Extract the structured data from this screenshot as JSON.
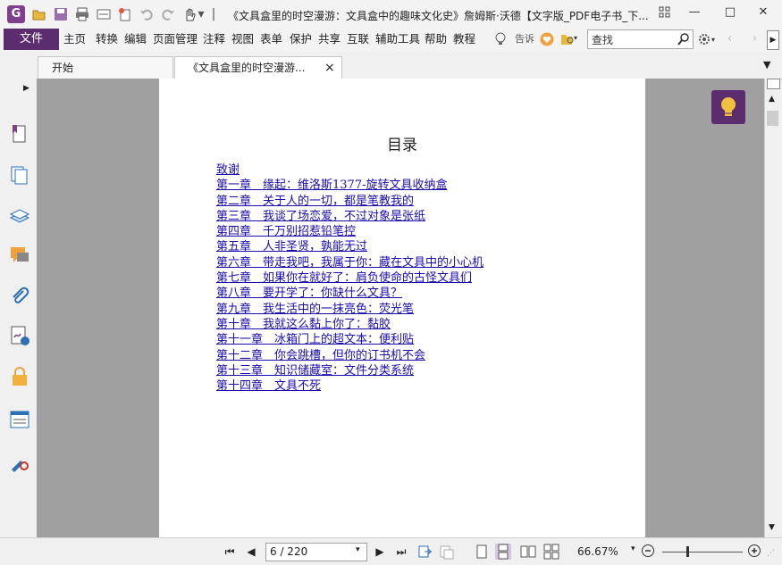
{
  "window": {
    "title": "《文具盒里的时空漫游：文具盒中的趣味文化史》詹姆斯·沃德【文字版_PDF电子书_下...",
    "minimize": "—",
    "maximize": "□",
    "close": "✕"
  },
  "app_icon": "G",
  "menu": {
    "file": "文件",
    "items": [
      "主页",
      "转换",
      "编辑",
      "页面管理",
      "注释",
      "视图",
      "表单",
      "保护",
      "共享",
      "互联",
      "辅助工具",
      "帮助",
      "教程"
    ],
    "tell": "告诉",
    "search_placeholder": "查找"
  },
  "tabs": [
    {
      "label": "开始"
    },
    {
      "label": "《文具盒里的时空漫游...",
      "close": "×"
    }
  ],
  "document": {
    "toc_title": "目录",
    "toc": [
      "致谢",
      "第一章　缘起：维洛斯1377-旋转文具收纳盒",
      "第二章　关于人的一切，都是笔教我的",
      "第三章　我谈了场恋爱，不过对象是张纸",
      "第四章　千万别招惹铅笔控",
      "第五章　人非圣贤，孰能无过",
      "第六章　带走我吧，我属于你：藏在文具中的小心机",
      "第七章　如果你在就好了：肩负使命的古怪文具们",
      "第八章　要开学了：你缺什么文具？",
      "第九章　我生活中的一抹亮色：荧光笔",
      "第十章　我就这么黏上你了：黏胶",
      "第十一章　冰箱门上的超文本：便利贴",
      "第十二章　你会跳槽，但你的订书机不会",
      "第十三章　知识储藏室：文件分类系统",
      "第十四章　文具不死"
    ]
  },
  "status": {
    "page_indicator": "6 / 220",
    "zoom": "66.67%"
  },
  "colors": {
    "brand": "#5b2d6e",
    "link": "#1a0dab",
    "doc_bg": "#a0a0a0"
  },
  "icons": {
    "left_panel": [
      "bookmark-icon",
      "pages-icon",
      "layers-icon",
      "comments-icon",
      "attachments-icon",
      "signature-icon",
      "security-icon",
      "form-icon",
      "certify-icon"
    ]
  }
}
